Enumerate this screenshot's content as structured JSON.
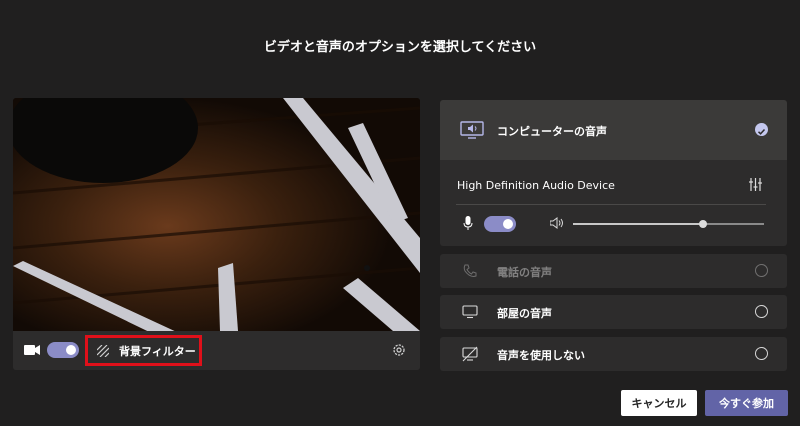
{
  "dialog": {
    "title": "ビデオと音声のオプションを選択してください"
  },
  "video": {
    "camera_on": true,
    "background_filter_label": "背景フィルター"
  },
  "audio": {
    "computer_audio_label": "コンピューターの音声",
    "computer_audio_selected": true,
    "device_name": "High Definition Audio Device",
    "mic_on": true,
    "volume_fraction": 0.68,
    "phone_audio_label": "電話の音声",
    "room_audio_label": "部屋の音声",
    "no_audio_label": "音声を使用しない"
  },
  "buttons": {
    "cancel_label": "キャンセル",
    "join_label": "今すぐ参加"
  },
  "colors": {
    "accent": "#6264a7",
    "toggle_on": "#8b8cc7",
    "highlight_box": "#e0101a",
    "background": "#201f1f"
  },
  "icons": {
    "camera": "camera-icon",
    "background_filter": "background-filter-icon",
    "settings": "gear-icon",
    "computer_audio": "computer-speaker-icon",
    "check": "checkmark-icon",
    "device_settings": "sliders-icon",
    "mic": "microphone-icon",
    "speaker": "speaker-icon",
    "phone": "phone-icon",
    "room": "monitor-icon",
    "no_audio": "no-audio-icon"
  }
}
